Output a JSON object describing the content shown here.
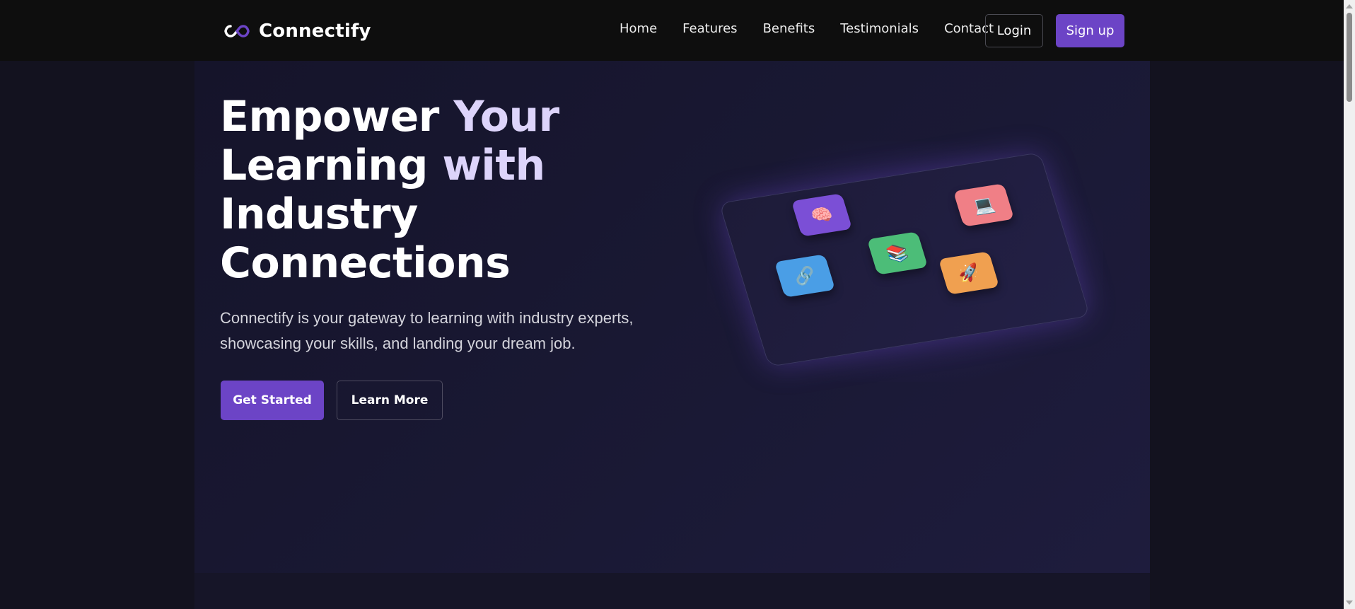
{
  "brand": {
    "name": "Connectify"
  },
  "nav": {
    "items": [
      {
        "label": "Home"
      },
      {
        "label": "Features"
      },
      {
        "label": "Benefits"
      },
      {
        "label": "Testimonials"
      },
      {
        "label": "Contact"
      }
    ],
    "login_label": "Login",
    "signup_label": "Sign up"
  },
  "hero": {
    "headline": {
      "line1_a": "Empower ",
      "line1_b": "Your",
      "line2_a": "Learning ",
      "line2_b": "with",
      "line3": "Industry",
      "line4": "Connections"
    },
    "subtitle": "Connectify is your gateway to learning with industry experts, showcasing your skills, and landing your dream job.",
    "primary_cta": "Get Started",
    "secondary_cta": "Learn More"
  },
  "illustration": {
    "tiles": [
      {
        "icon": "brain-icon",
        "glyph": "🧠",
        "color": "#7b4fd6"
      },
      {
        "icon": "laptop-icon",
        "glyph": "💻",
        "color": "#f07f86"
      },
      {
        "icon": "books-icon",
        "glyph": "📚",
        "color": "#4cbd78"
      },
      {
        "icon": "link-icon",
        "glyph": "🔗",
        "color": "#4a9ee6"
      },
      {
        "icon": "rocket-icon",
        "glyph": "🚀",
        "color": "#f0a050"
      }
    ]
  },
  "colors": {
    "accent": "#6c44c6",
    "headline_highlight": "#ddd4fb",
    "header_bg": "#0e0e0e",
    "page_bg": "#13121f"
  }
}
